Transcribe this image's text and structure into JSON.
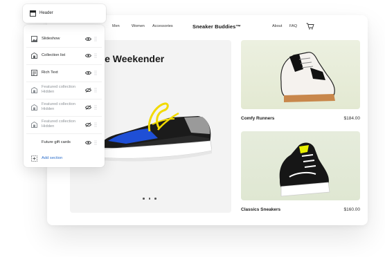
{
  "editor": {
    "header_label": "Header",
    "sections": [
      {
        "label": "Slideshow",
        "icon": "slideshow-icon",
        "visible": true
      },
      {
        "label": "Collection list",
        "icon": "collection-list-icon",
        "visible": true
      },
      {
        "label": "Rich Text",
        "icon": "rich-text-icon",
        "visible": true
      },
      {
        "label": "Featured collection",
        "sublabel": "Hidden",
        "icon": "featured-collection-icon",
        "visible": false
      },
      {
        "label": "Featured collection",
        "sublabel": "Hidden",
        "icon": "featured-collection-icon",
        "visible": false
      },
      {
        "label": "Featured collection",
        "sublabel": "Hidden",
        "icon": "featured-collection-icon",
        "visible": false
      },
      {
        "label": "Future gift cards",
        "icon": "",
        "visible": true
      }
    ],
    "add_section_label": "Add section",
    "colors": {
      "accent": "#2c6ecb",
      "hidden_text": "#8c9196"
    }
  },
  "store": {
    "nav_left": [
      "Men",
      "Women",
      "Accessories"
    ],
    "brand": "Sneaker Buddies™",
    "nav_right": [
      "About",
      "FAQ"
    ],
    "hero": {
      "title": "The Weekender"
    },
    "products": [
      {
        "name": "Comfy Runners",
        "price": "$184.00"
      },
      {
        "name": "Classics Sneakers",
        "price": "$160.00"
      }
    ]
  }
}
